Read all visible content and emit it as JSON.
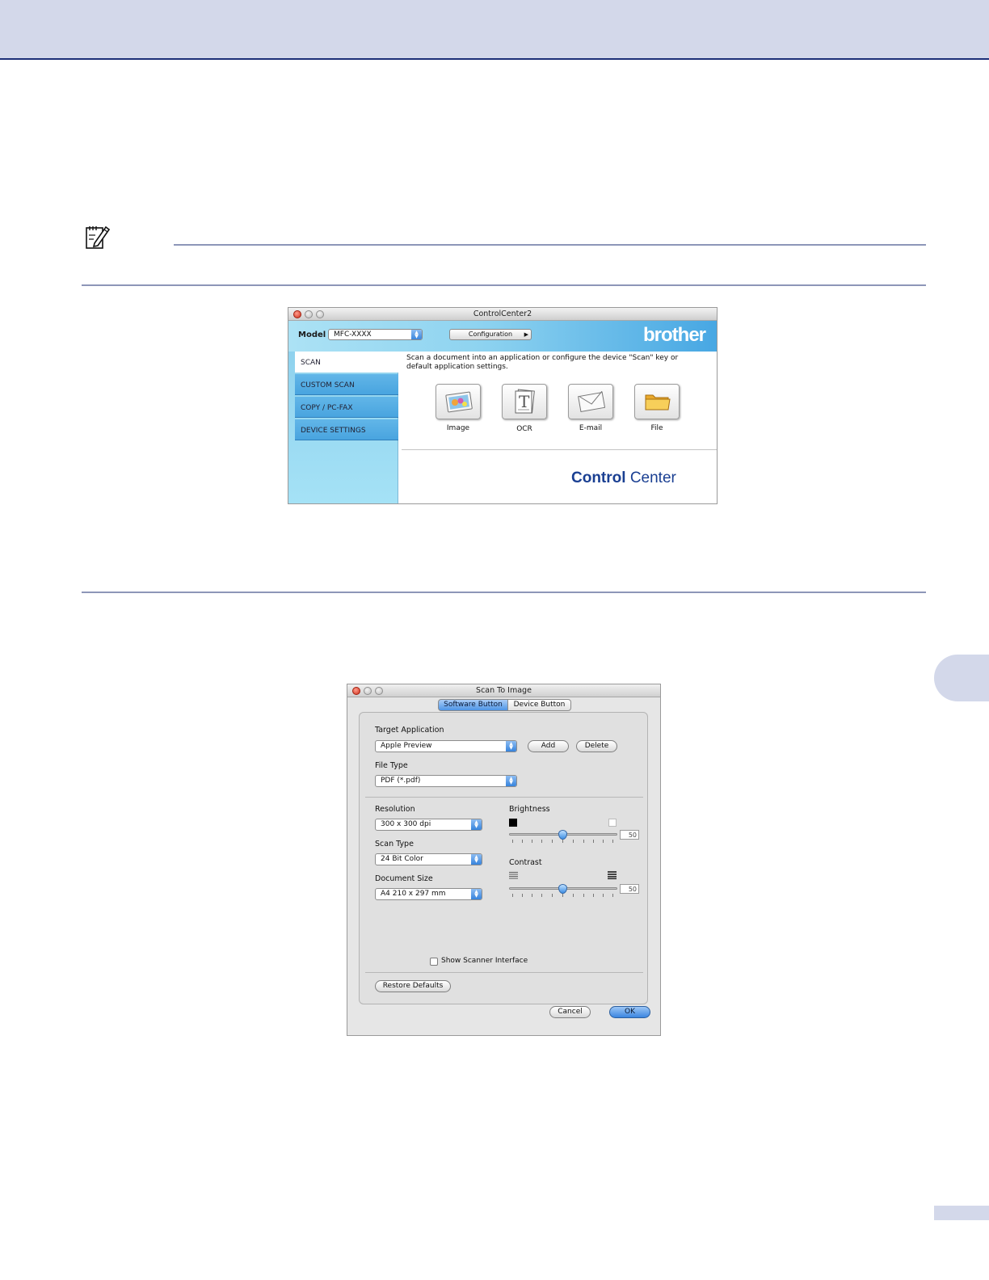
{
  "controlcenter": {
    "title": "ControlCenter2",
    "model_label": "Model",
    "model_value": "MFC-XXXX",
    "configuration_label": "Configuration",
    "brand": "brother",
    "nav": [
      "SCAN",
      "CUSTOM SCAN",
      "COPY / PC-FAX",
      "DEVICE SETTINGS"
    ],
    "selected_nav": "SCAN",
    "description": "Scan a document into an application or configure the device \"Scan\" key or default application settings.",
    "buttons": [
      {
        "label": "Image",
        "icon": "image-icon"
      },
      {
        "label": "OCR",
        "icon": "ocr-document-icon"
      },
      {
        "label": "E-mail",
        "icon": "envelope-icon"
      },
      {
        "label": "File",
        "icon": "folder-icon"
      }
    ],
    "logo_bold": "Control",
    "logo_regular": "Center"
  },
  "scan_dialog": {
    "title": "Scan To Image",
    "tabs": [
      "Software Button",
      "Device Button"
    ],
    "selected_tab": "Software Button",
    "target_application_label": "Target Application",
    "target_application_value": "Apple Preview",
    "add_label": "Add",
    "delete_label": "Delete",
    "file_type_label": "File Type",
    "file_type_value": "PDF (*.pdf)",
    "resolution_label": "Resolution",
    "resolution_value": "300 x 300 dpi",
    "scan_type_label": "Scan Type",
    "scan_type_value": "24 Bit Color",
    "document_size_label": "Document Size",
    "document_size_value": "A4  210 x 297 mm",
    "brightness_label": "Brightness",
    "brightness_value": "50",
    "contrast_label": "Contrast",
    "contrast_value": "50",
    "show_scanner_interface_label": "Show Scanner Interface",
    "show_scanner_interface_checked": false,
    "restore_defaults_label": "Restore Defaults",
    "cancel_label": "Cancel",
    "ok_label": "OK"
  },
  "colors": {
    "page_band": "#d3d8ea",
    "band_rule": "#1d2f78",
    "accent_blue": "#3a86dd",
    "logo_blue": "#1a3f92"
  }
}
